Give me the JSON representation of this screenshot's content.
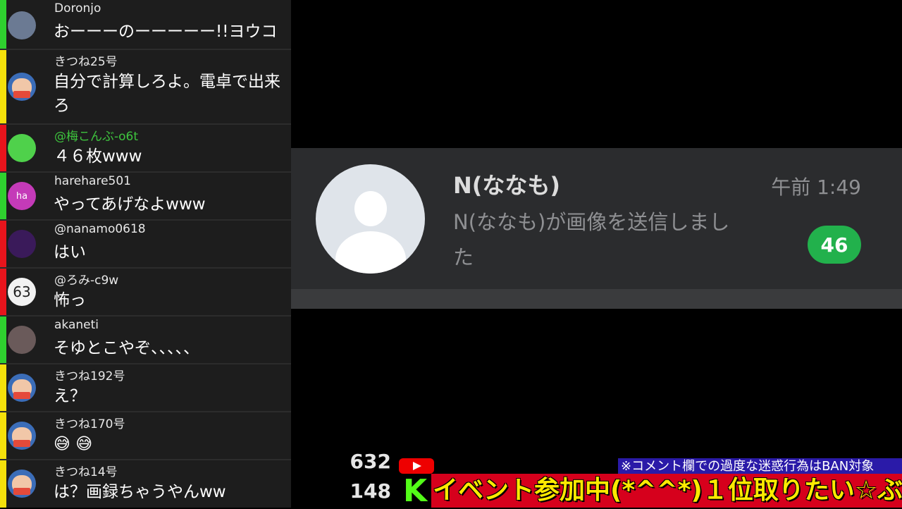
{
  "chat": [
    {
      "user": "Doronjo",
      "text": "おーーーのーーーーー!!ヨウコ",
      "bar": "#2fd12f"
    },
    {
      "user": "きつね25号",
      "text": "自分で計算しろよ。電卓で出来ろ",
      "bar": "#f5e10b"
    },
    {
      "user": "@梅こんぶ-o6t",
      "text": "４６枚www",
      "bar": "#e8141c",
      "user_color": "#3ec43e"
    },
    {
      "user": "harehare501",
      "text": "やってあげなよwww",
      "bar": "#2fd12f",
      "avatar_text": "ha"
    },
    {
      "user": "@nanamo0618",
      "text": "はい",
      "bar": "#e8141c"
    },
    {
      "user": "@ろみ-c9w",
      "text": "怖っ",
      "bar": "#e8141c",
      "avatar_text": "63"
    },
    {
      "user": "akaneti",
      "text": "そゆとこやぞ、、、、、",
      "bar": "#2fd12f"
    },
    {
      "user": "きつね192号",
      "text": "え？",
      "bar": "#f5e10b"
    },
    {
      "user": "きつね170号",
      "text": "😅 😅",
      "bar": "#f5e10b"
    },
    {
      "user": "きつね14号",
      "text": "は？画録ちゃうやんww",
      "bar": "#f5e10b"
    }
  ],
  "notification": {
    "sender": "N(ななも)",
    "preview": "N(ななも)が画像を送信しました",
    "time": "午前 1:49",
    "unread_count": "46"
  },
  "overlay": {
    "count_top": "632",
    "count_bottom": "148",
    "notice": "※コメント欄での過度な迷惑行為はBAN対象",
    "banner": "イベント参加中(*^^*)１位取りたい☆ぶ"
  }
}
